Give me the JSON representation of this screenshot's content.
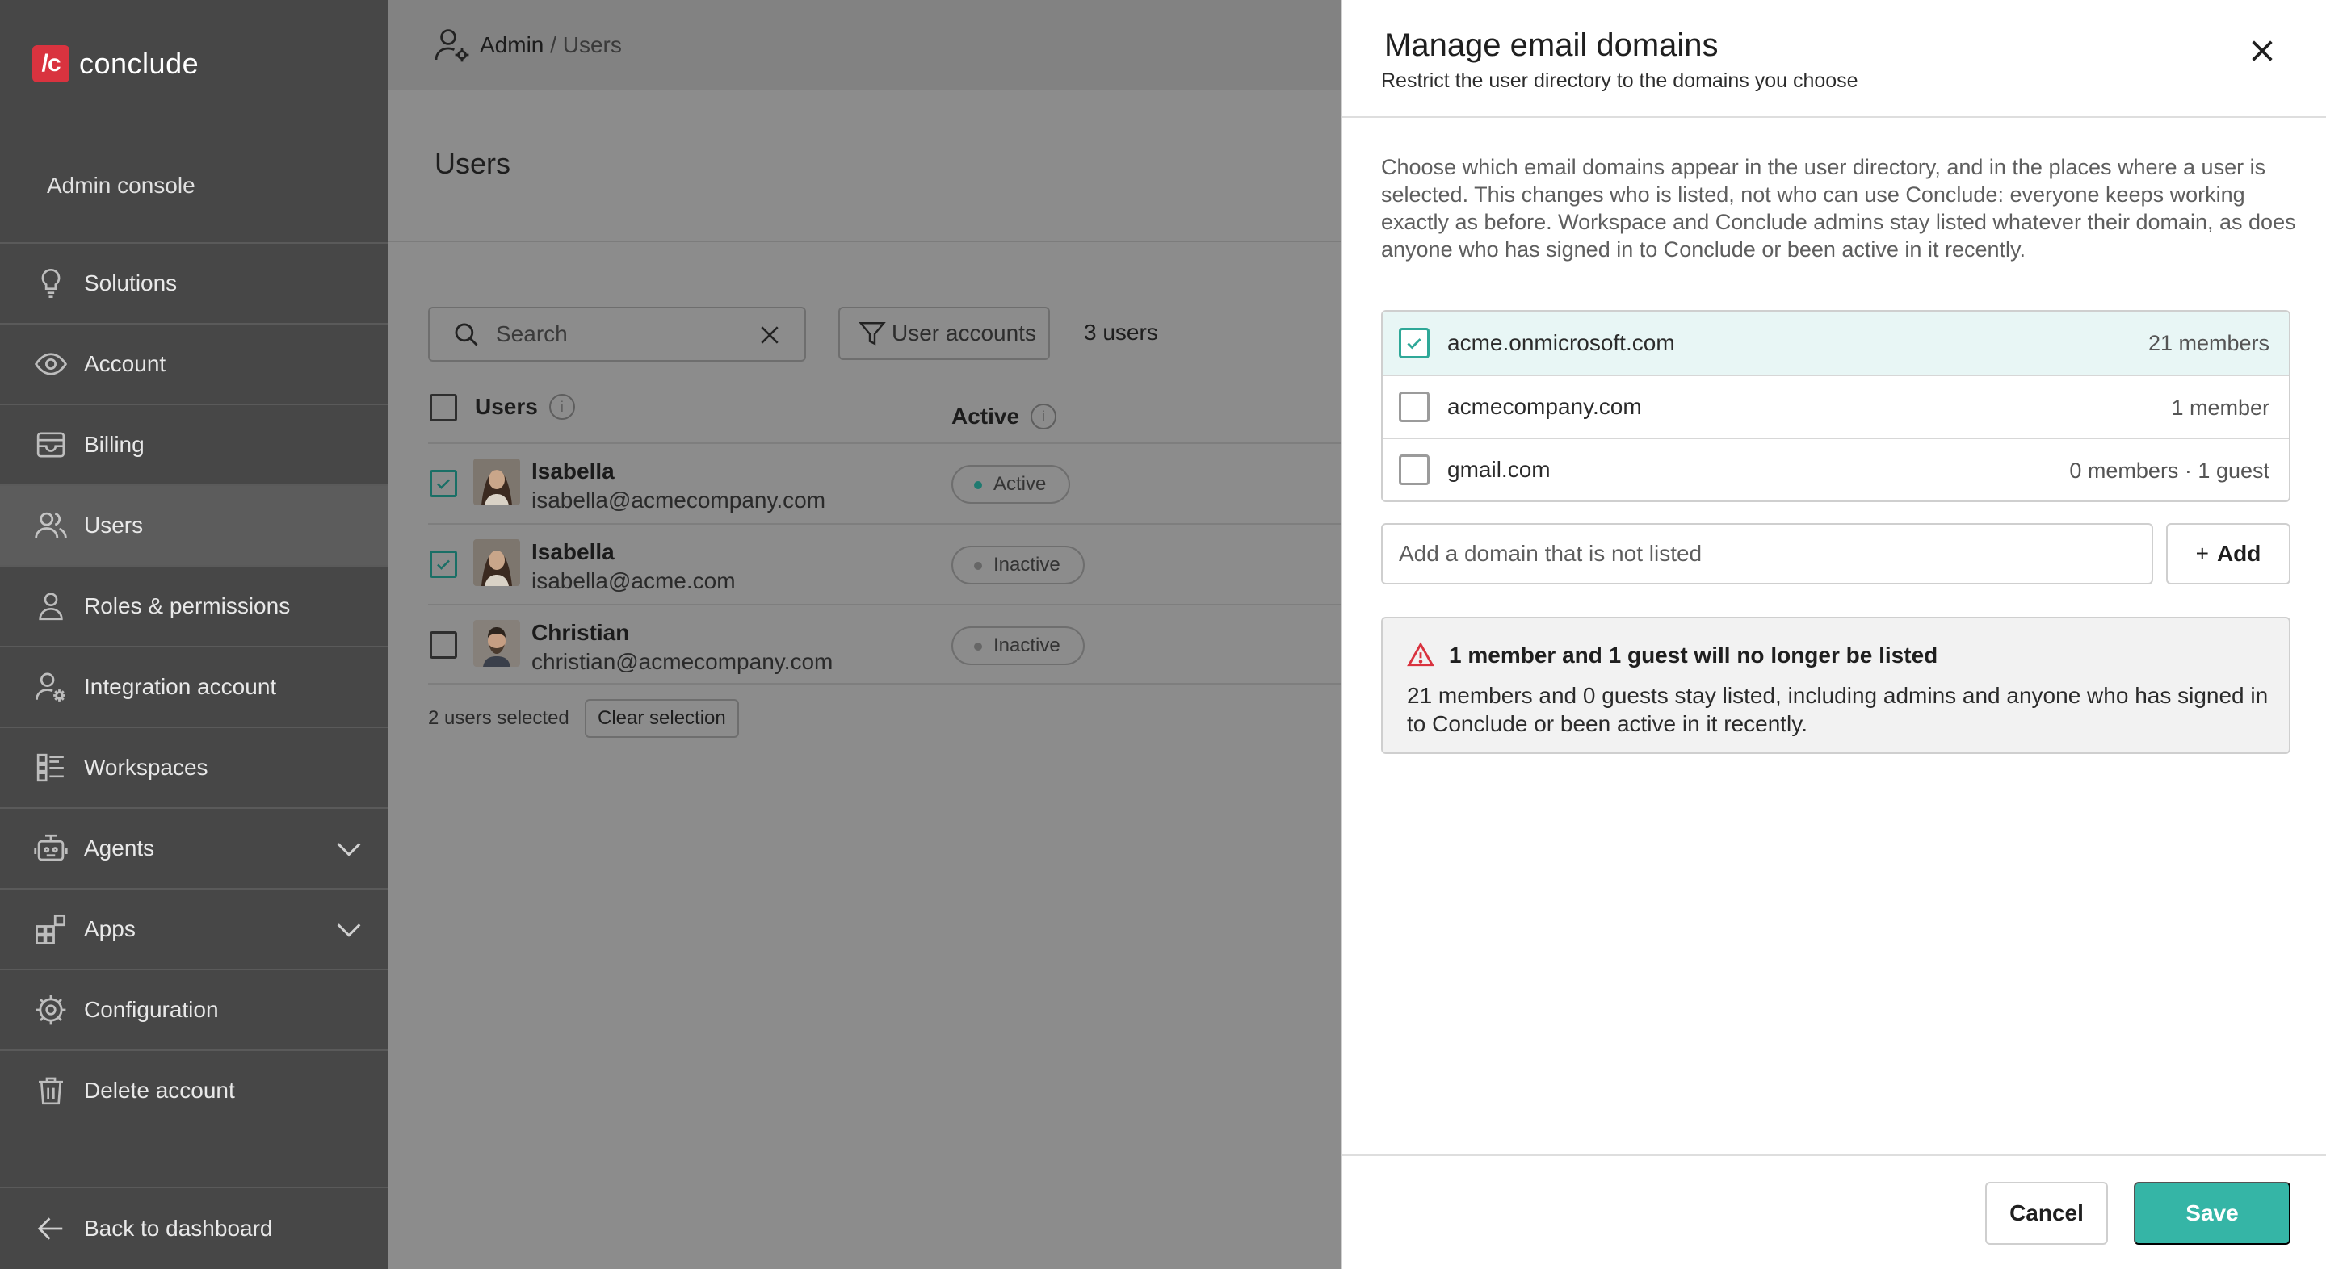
{
  "brand": {
    "mark": "/c",
    "name": "conclude",
    "accent": "#d9333f"
  },
  "sidebar": {
    "console_label": "Admin console",
    "items": [
      {
        "label": "Solutions",
        "icon": "lightbulb-icon"
      },
      {
        "label": "Account",
        "icon": "eye-icon"
      },
      {
        "label": "Billing",
        "icon": "wallet-icon"
      },
      {
        "label": "Users",
        "icon": "users-icon",
        "active": true
      },
      {
        "label": "Roles & permissions",
        "icon": "person-icon"
      },
      {
        "label": "Integration account",
        "icon": "person-gear-icon"
      },
      {
        "label": "Workspaces",
        "icon": "list-icon"
      },
      {
        "label": "Agents",
        "icon": "robot-icon",
        "expandable": true
      },
      {
        "label": "Apps",
        "icon": "apps-icon",
        "expandable": true
      },
      {
        "label": "Configuration",
        "icon": "gear-icon"
      },
      {
        "label": "Delete account",
        "icon": "trash-icon"
      }
    ],
    "back_label": "Back to dashboard"
  },
  "main": {
    "breadcrumb": {
      "root": "Admin",
      "sep": " / ",
      "current": "Users"
    },
    "title": "Users",
    "search_placeholder": "Search",
    "filter_label": "User accounts",
    "user_count": "3 users",
    "columns": {
      "users": "Users",
      "active": "Active"
    },
    "rows": [
      {
        "name": "Isabella",
        "email": "isabella@acmecompany.com",
        "status": "Active",
        "checked": true
      },
      {
        "name": "Isabella",
        "email": "isabella@acme.com",
        "status": "Inactive",
        "checked": true
      },
      {
        "name": "Christian",
        "email": "christian@acmecompany.com",
        "status": "Inactive",
        "checked": false
      }
    ],
    "selection_info": "2 users selected",
    "clear_label": "Clear selection"
  },
  "drawer": {
    "title": "Manage email domains",
    "subtitle": "Restrict the user directory to the domains you choose",
    "intro": "Choose which email domains appear in the user directory, and in the places where a user is selected. This changes who is listed, not who can use Conclude: everyone keeps working exactly as before. Workspace and Conclude admins stay listed whatever their domain, as does anyone who has signed in to Conclude or been active in it recently.",
    "domains": [
      {
        "domain": "acme.onmicrosoft.com",
        "count": "21 members",
        "checked": true
      },
      {
        "domain": "acmecompany.com",
        "count": "1 member",
        "checked": false
      },
      {
        "domain": "gmail.com",
        "count": "0 members · 1 guest",
        "checked": false
      }
    ],
    "add_placeholder": "Add a domain that is not listed",
    "add_label": "Add",
    "add_plus": "+",
    "warning": {
      "title": "1 member and 1 guest will no longer be listed",
      "body": "21 members and 0 guests stay listed, including admins and anyone who has signed in to Conclude or been active in it recently."
    },
    "cancel_label": "Cancel",
    "save_label": "Save",
    "colors": {
      "primary": "#35b5a6",
      "warning": "#d9333f"
    }
  }
}
